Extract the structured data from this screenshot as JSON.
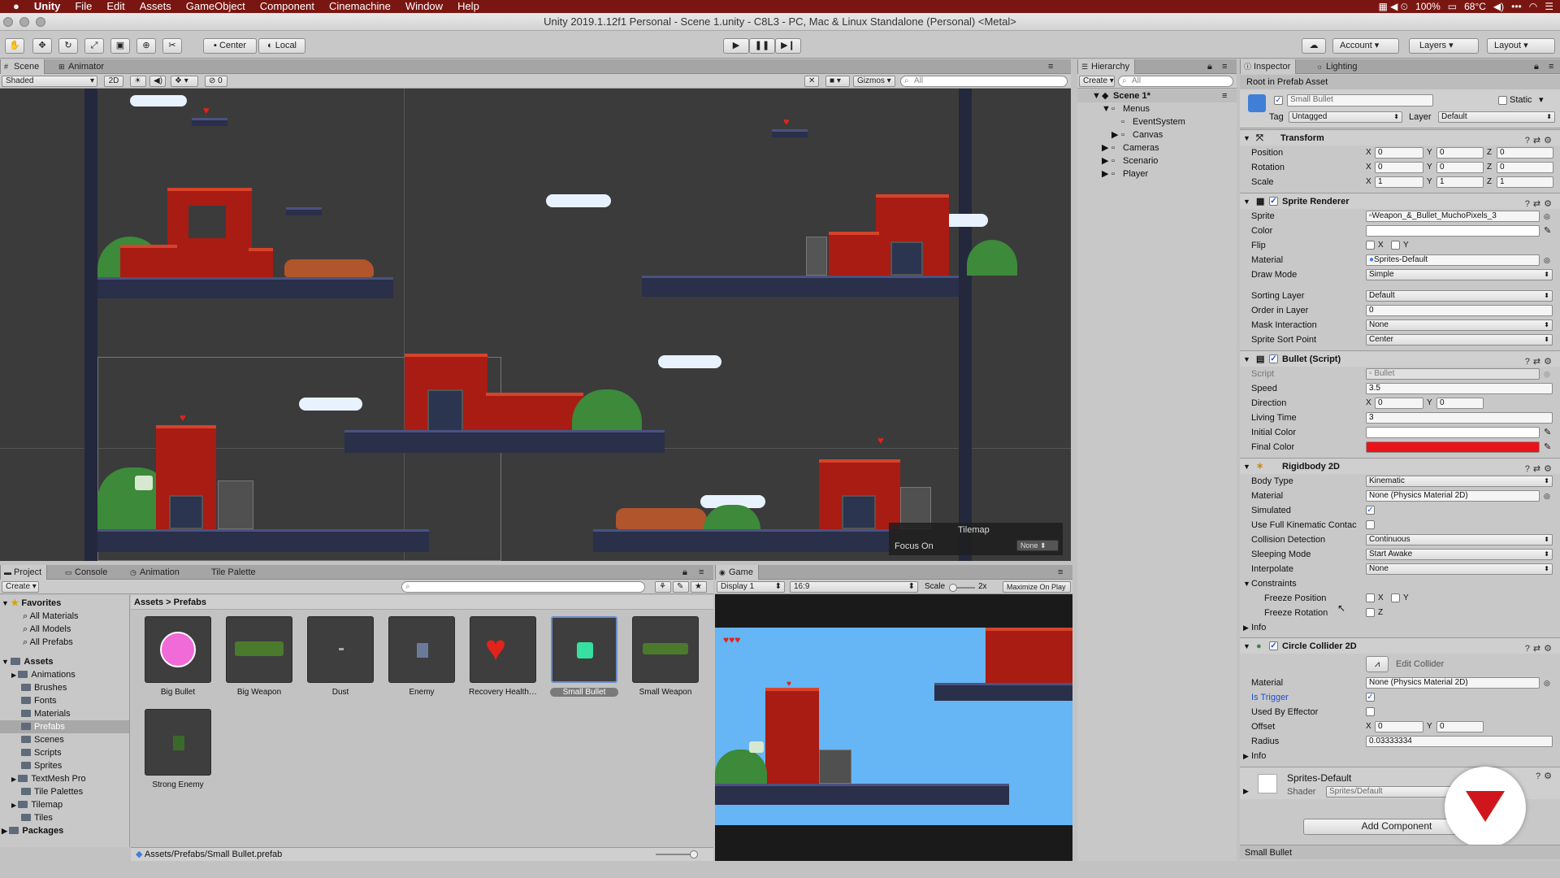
{
  "menubar": {
    "apple": "",
    "items": [
      "Unity",
      "File",
      "Edit",
      "Assets",
      "GameObject",
      "Component",
      "Cinemachine",
      "Window",
      "Help"
    ],
    "status": {
      "battery": "100%",
      "temp": "68°C"
    }
  },
  "titlebar": {
    "title": "Unity 2019.1.12f1 Personal - Scene 1.unity - C8L3 - PC, Mac & Linux Standalone (Personal) <Metal>"
  },
  "toolbar": {
    "pivot": "Center",
    "space": "Local",
    "account": "Account",
    "layers": "Layers",
    "layout": "Layout"
  },
  "scene": {
    "tab_scene": "Scene",
    "tab_animator": "Animator",
    "shading": "Shaded",
    "mode_2d": "2D",
    "fx_count": "0",
    "gizmos": "Gizmos",
    "search_placeholder": "All",
    "overlay_title": "Tilemap",
    "focus_label": "Focus On",
    "focus_value": "None"
  },
  "hierarchy": {
    "tab": "Hierarchy",
    "create": "Create",
    "search_placeholder": "All",
    "scene_name": "Scene 1*",
    "items": [
      {
        "label": "Menus"
      },
      {
        "label": "EventSystem"
      },
      {
        "label": "Canvas"
      },
      {
        "label": "Cameras"
      },
      {
        "label": "Scenario"
      },
      {
        "label": "Player"
      }
    ]
  },
  "inspector": {
    "tab_inspector": "Inspector",
    "tab_lighting": "Lighting",
    "root_label": "Root in Prefab Asset",
    "object_name": "Small Bullet",
    "static_label": "Static",
    "tag_label": "Tag",
    "tag_value": "Untagged",
    "layer_label": "Layer",
    "layer_value": "Default",
    "transform": {
      "title": "Transform",
      "position_label": "Position",
      "px": "0",
      "py": "0",
      "pz": "0",
      "rotation_label": "Rotation",
      "rx": "0",
      "ry": "0",
      "rz": "0",
      "scale_label": "Scale",
      "sx": "1",
      "sy": "1",
      "sz": "1"
    },
    "sprite_renderer": {
      "title": "Sprite Renderer",
      "sprite_label": "Sprite",
      "sprite_value": "Weapon_&_Bullet_MuchoPixels_3",
      "color_label": "Color",
      "flip_label": "Flip",
      "material_label": "Material",
      "material_value": "Sprites-Default",
      "drawmode_label": "Draw Mode",
      "drawmode_value": "Simple",
      "sortinglayer_label": "Sorting Layer",
      "sortinglayer_value": "Default",
      "order_label": "Order in Layer",
      "order_value": "0",
      "mask_label": "Mask Interaction",
      "mask_value": "None",
      "sortpoint_label": "Sprite Sort Point",
      "sortpoint_value": "Center"
    },
    "bullet_script": {
      "title": "Bullet (Script)",
      "script_label": "Script",
      "script_value": "Bullet",
      "speed_label": "Speed",
      "speed_value": "3.5",
      "direction_label": "Direction",
      "dx": "0",
      "dy": "0",
      "living_label": "Living Time",
      "living_value": "3",
      "initial_label": "Initial Color",
      "initial_color": "#ffffff",
      "final_label": "Final Color",
      "final_color": "#e8141a"
    },
    "rigidbody": {
      "title": "Rigidbody 2D",
      "bodytype_label": "Body Type",
      "bodytype_value": "Kinematic",
      "material_label": "Material",
      "material_value": "None (Physics Material 2D)",
      "simulated_label": "Simulated",
      "fullkin_label": "Use Full Kinematic Contac",
      "collision_label": "Collision Detection",
      "collision_value": "Continuous",
      "sleeping_label": "Sleeping Mode",
      "sleeping_value": "Start Awake",
      "interpolate_label": "Interpolate",
      "interpolate_value": "None",
      "constraints_label": "Constraints",
      "freezepos_label": "Freeze Position",
      "freezerot_label": "Freeze Rotation",
      "info_label": "Info"
    },
    "circle_collider": {
      "title": "Circle Collider 2D",
      "edit_label": "Edit Collider",
      "material_label": "Material",
      "material_value": "None (Physics Material 2D)",
      "trigger_label": "Is Trigger",
      "effector_label": "Used By Effector",
      "offset_label": "Offset",
      "ox": "0",
      "oy": "0",
      "radius_label": "Radius",
      "radius_value": "0.03333334",
      "info_label": "Info"
    },
    "material": {
      "name": "Sprites-Default",
      "shader_label": "Shader",
      "shader_value": "Sprites/Default"
    },
    "add_component": "Add Component",
    "footer": "Small Bullet"
  },
  "project": {
    "tab_project": "Project",
    "tab_console": "Console",
    "tab_animation": "Animation",
    "tab_palette": "Tile Palette",
    "create": "Create",
    "breadcrumb_root": "Assets",
    "breadcrumb_sep": ">",
    "breadcrumb_current": "Prefabs",
    "favorites_label": "Favorites",
    "favorites": [
      "All Materials",
      "All Models",
      "All Prefabs"
    ],
    "assets_label": "Assets",
    "folders": [
      "Animations",
      "Brushes",
      "Fonts",
      "Materials",
      "Prefabs",
      "Scenes",
      "Scripts",
      "Sprites",
      "TextMesh Pro",
      "Tile Palettes",
      "Tilemap",
      "Tiles"
    ],
    "packages_label": "Packages",
    "prefabs": [
      "Big Bullet",
      "Big Weapon",
      "Dust",
      "Enemy",
      "Recovery Health B...",
      "Small Bullet",
      "Small Weapon",
      "Strong Enemy"
    ],
    "path": "Assets/Prefabs/Small Bullet.prefab"
  },
  "game": {
    "tab": "Game",
    "display": "Display 1",
    "aspect": "16:9",
    "scale_label": "Scale",
    "scale_value": "2x",
    "maximize": "Maximize On Play"
  }
}
